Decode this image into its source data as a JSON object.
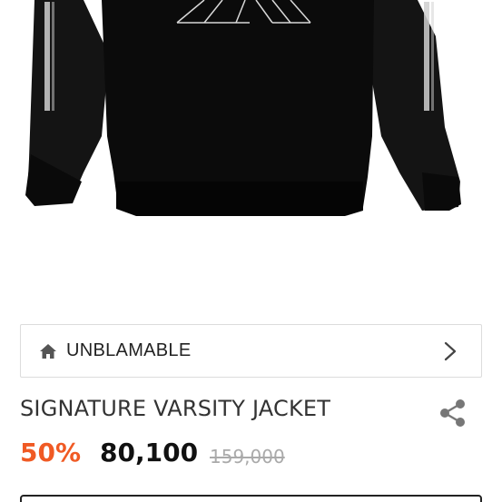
{
  "product_image": {
    "icon": "jacket-image",
    "alt_colors": {
      "body": "#0b0b0b",
      "sleeve": "#1a1a1a"
    }
  },
  "brand": {
    "name": "UNBLAMABLE",
    "icon": "home-icon",
    "chevron": "chevron-right-icon"
  },
  "product": {
    "title": "SIGNATURE VARSITY JACKET",
    "discount": "50%",
    "sale_price": "80,100",
    "original_price": "159,000",
    "share_icon": "share-icon"
  },
  "colors": {
    "discount": "#f05a24",
    "price": "#111111",
    "original_price": "#aaaaaa",
    "border": "#dcdcdc"
  }
}
